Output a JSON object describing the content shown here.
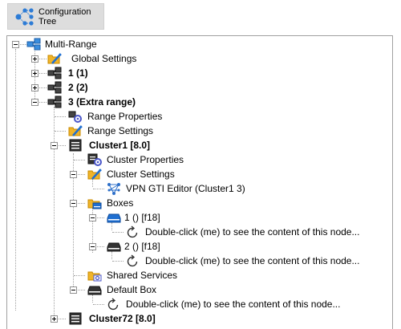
{
  "toolbar": {
    "config_tree_label_line1": "Configuration",
    "config_tree_label_line2": "Tree"
  },
  "tree": {
    "root": "Multi-Range",
    "global_settings": "Global Settings",
    "range1": "1 (1)",
    "range2": "2 (2)",
    "range3": "3 (Extra range)",
    "range_properties": "Range Properties",
    "range_settings": "Range Settings",
    "cluster1": "Cluster1 [8.0]",
    "cluster_properties": "Cluster Properties",
    "cluster_settings": "Cluster Settings",
    "vpn_gti_editor": "VPN GTI Editor (Cluster1 3)",
    "boxes": "Boxes",
    "box1": "1 () [f18]",
    "box1_placeholder": "Double-click (me) to see the content of this node...",
    "box2": "2 () [f18]",
    "box2_placeholder": "Double-click (me) to see the content of this node...",
    "shared_services": "Shared Services",
    "default_box": "Default Box",
    "default_box_placeholder": "Double-click (me) to see the content of this node...",
    "cluster72": "Cluster72 [8.0]"
  }
}
